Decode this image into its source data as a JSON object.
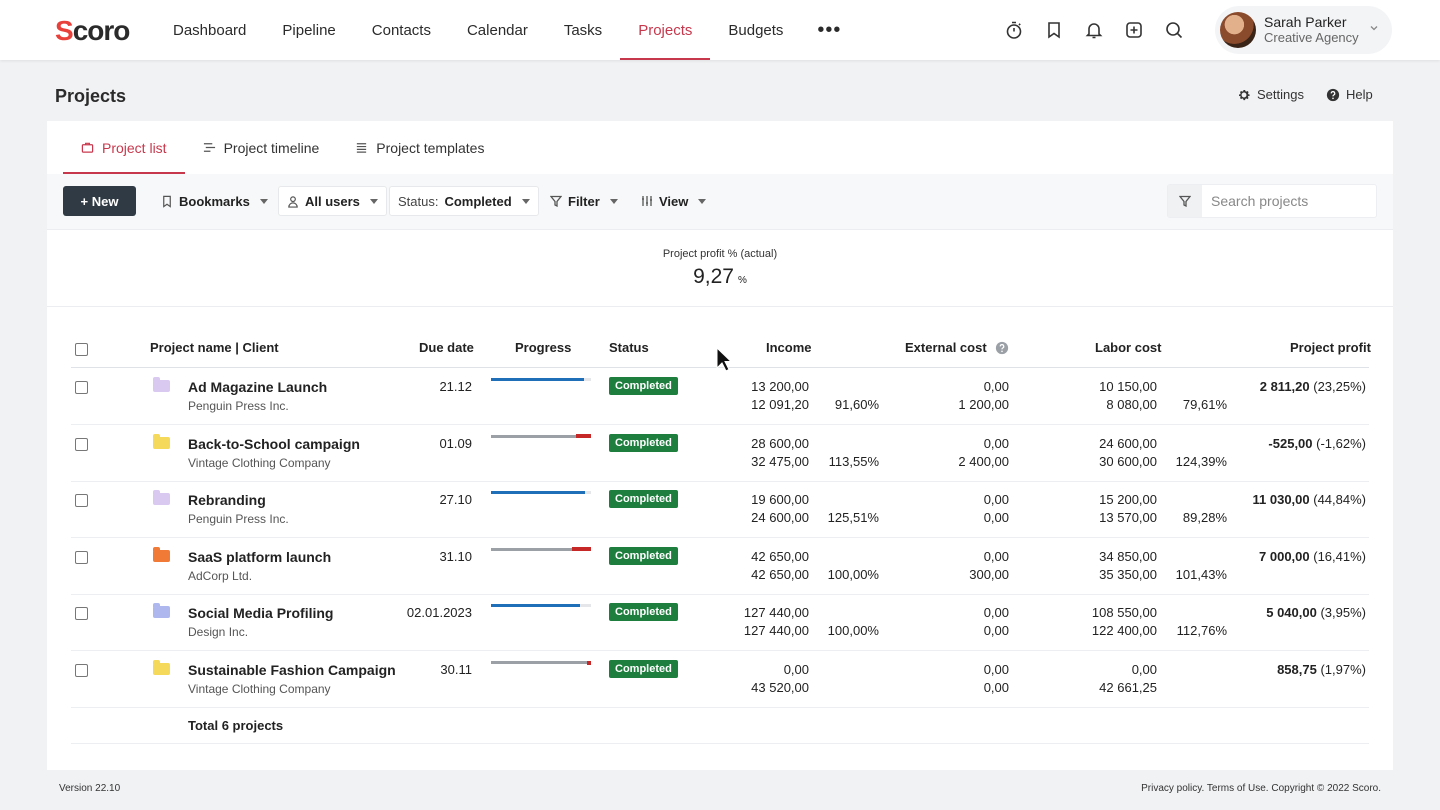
{
  "nav": {
    "logo": "Scoro",
    "items": [
      {
        "label": "Dashboard",
        "active": false
      },
      {
        "label": "Pipeline",
        "active": false
      },
      {
        "label": "Contacts",
        "active": false
      },
      {
        "label": "Calendar",
        "active": false
      },
      {
        "label": "Tasks",
        "active": false
      },
      {
        "label": "Projects",
        "active": true
      },
      {
        "label": "Budgets",
        "active": false
      }
    ],
    "more": "•••",
    "icons": [
      "timer-icon",
      "bookmark-icon",
      "bell-icon",
      "add-square-icon",
      "search-icon"
    ],
    "user": {
      "name": "Sarah Parker",
      "org": "Creative Agency"
    }
  },
  "header": {
    "title": "Projects",
    "settings": "Settings",
    "help": "Help"
  },
  "tabs": [
    {
      "label": "Project list",
      "active": true
    },
    {
      "label": "Project timeline",
      "active": false
    },
    {
      "label": "Project templates",
      "active": false
    }
  ],
  "toolbar": {
    "new_label": "+ New",
    "bookmarks": "Bookmarks",
    "users": "All users",
    "status_prefix": "Status:",
    "status_value": "Completed",
    "filter": "Filter",
    "view": "View",
    "search_placeholder": "Search projects"
  },
  "kpi": {
    "label": "Project profit % (actual)",
    "value": "9,27",
    "unit": "%"
  },
  "table": {
    "headers": {
      "name": "Project name | Client",
      "due": "Due date",
      "progress": "Progress",
      "status": "Status",
      "income": "Income",
      "external": "External cost",
      "labor": "Labor cost",
      "profit": "Project profit"
    },
    "rows": [
      {
        "name": "Ad Magazine Launch",
        "client": "Penguin Press Inc.",
        "due": "21.12",
        "folder": "#d9c8f0",
        "progress": 0.93,
        "over": 0,
        "status": "Completed",
        "income_plan": "13 200,00",
        "income_act": "12 091,20",
        "income_pct": "91,60%",
        "ext_plan": "0,00",
        "ext_act": "1 200,00",
        "labor_plan": "10 150,00",
        "labor_act": "8 080,00",
        "labor_pct": "79,61%",
        "profit": "2 811,20",
        "profit_pct": "(23,25%)"
      },
      {
        "name": "Back-to-School campaign",
        "client": "Vintage Clothing Company",
        "due": "01.09",
        "folder": "#f5d95a",
        "progress": 0.85,
        "over": 0.15,
        "status": "Completed",
        "income_plan": "28 600,00",
        "income_act": "32 475,00",
        "income_pct": "113,55%",
        "ext_plan": "0,00",
        "ext_act": "2 400,00",
        "labor_plan": "24 600,00",
        "labor_act": "30 600,00",
        "labor_pct": "124,39%",
        "profit": "-525,00",
        "profit_pct": "(-1,62%)"
      },
      {
        "name": "Rebranding",
        "client": "Penguin Press Inc.",
        "due": "27.10",
        "folder": "#d9c8f0",
        "progress": 0.94,
        "over": 0,
        "status": "Completed",
        "income_plan": "19 600,00",
        "income_act": "24 600,00",
        "income_pct": "125,51%",
        "ext_plan": "0,00",
        "ext_act": "0,00",
        "labor_plan": "15 200,00",
        "labor_act": "13 570,00",
        "labor_pct": "89,28%",
        "profit": "11 030,00",
        "profit_pct": "(44,84%)"
      },
      {
        "name": "SaaS platform launch",
        "client": "AdCorp Ltd.",
        "due": "31.10",
        "folder": "#f07a36",
        "progress": 0.81,
        "over": 0.19,
        "status": "Completed",
        "income_plan": "42 650,00",
        "income_act": "42 650,00",
        "income_pct": "100,00%",
        "ext_plan": "0,00",
        "ext_act": "300,00",
        "labor_plan": "34 850,00",
        "labor_act": "35 350,00",
        "labor_pct": "101,43%",
        "profit": "7 000,00",
        "profit_pct": "(16,41%)"
      },
      {
        "name": "Social Media Profiling",
        "client": "Design Inc.",
        "due": "02.01.2023",
        "folder": "#aeb8ee",
        "progress": 0.89,
        "over": 0,
        "status": "Completed",
        "income_plan": "127 440,00",
        "income_act": "127 440,00",
        "income_pct": "100,00%",
        "ext_plan": "0,00",
        "ext_act": "0,00",
        "labor_plan": "108 550,00",
        "labor_act": "122 400,00",
        "labor_pct": "112,76%",
        "profit": "5 040,00",
        "profit_pct": "(3,95%)"
      },
      {
        "name": "Sustainable Fashion Campaign",
        "client": "Vintage Clothing Company",
        "due": "30.11",
        "folder": "#f5d95a",
        "progress": 0.96,
        "over": 0.04,
        "status": "Completed",
        "income_plan": "0,00",
        "income_act": "43 520,00",
        "income_pct": "",
        "ext_plan": "0,00",
        "ext_act": "0,00",
        "labor_plan": "0,00",
        "labor_act": "42 661,25",
        "labor_pct": "",
        "profit": "858,75",
        "profit_pct": "(1,97%)"
      }
    ],
    "total": "Total 6 projects"
  },
  "footer": {
    "version": "Version 22.10",
    "legal": "Privacy policy. Terms of Use. Copyright © 2022 Scoro."
  },
  "colors": {
    "accent": "#c8384c",
    "badge": "#1e7e3e",
    "progress": "#1f6fb8",
    "over": "#c62828"
  }
}
